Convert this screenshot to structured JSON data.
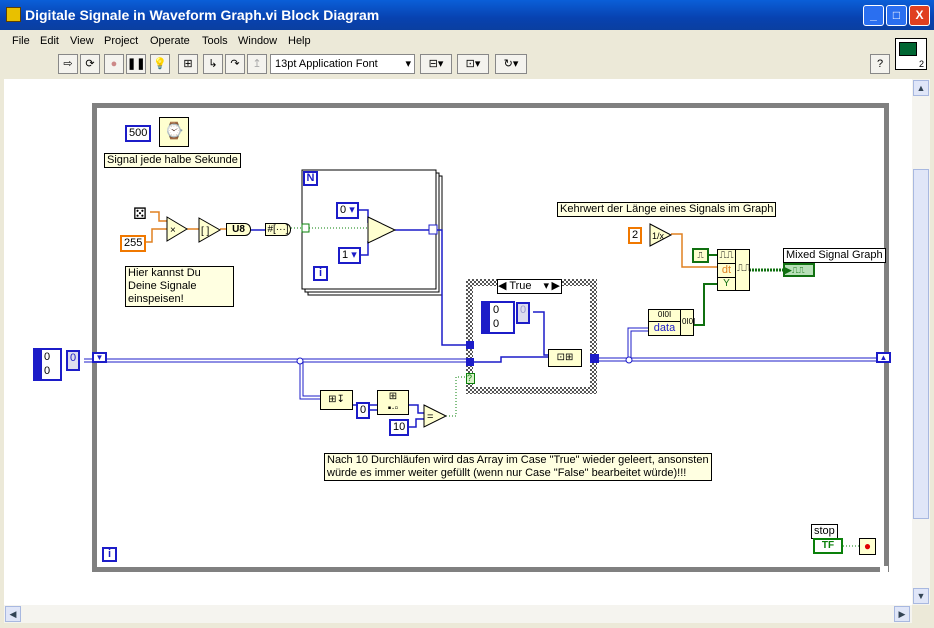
{
  "window": {
    "title": "Digitale Signale in Waveform Graph.vi Block Diagram",
    "minimize": "_",
    "maximize": "□",
    "close": "X"
  },
  "menu": [
    "File",
    "Edit",
    "View",
    "Project",
    "Operate",
    "Tools",
    "Window",
    "Help"
  ],
  "toolbar": {
    "font": "13pt Application Font",
    "help": "?",
    "run_icon": "run-arrow-icon",
    "pane_number": "2"
  },
  "diagram": {
    "wait_ms": "500",
    "label_wait": "Signal jede halbe Sekunde",
    "const_255": "255",
    "u8": "U8",
    "label_input": "Hier kannst Du Deine Signale einspeisen!",
    "for_N": "N",
    "for_i": "i",
    "ring0": "0",
    "ring1": "1",
    "array_init": [
      "0",
      "0"
    ],
    "array_index": "0",
    "case_selector": "True",
    "case_array": [
      "0",
      "0"
    ],
    "case_index": "0",
    "label_reciprocal": "Kehrwert der Länge eines Signals im Graph",
    "const_2": "2",
    "bw_dt": "dt",
    "bw_y": "Y",
    "data_node": "data",
    "data_node_top": "0I0I",
    "data_out": "0I0I",
    "graph_label": "Mixed Signal Graph",
    "index_0": "0",
    "const_10": "10",
    "equals": "=",
    "label_note_1": "Nach 10 Durchläufen wird das Array im Case \"True\" wieder geleert, ansonsten",
    "label_note_2": "würde es immer weiter gefüllt (wenn nur Case \"False\" bearbeitet würde)!!!",
    "while_i": "i",
    "stop_label": "stop",
    "stop_tf": "TF",
    "case_q": "?"
  },
  "colors": {
    "integer": "#1c1cc8",
    "double": "#f07800",
    "digital": "#107010",
    "boolean": "#0a800a",
    "frame": "#808080"
  }
}
